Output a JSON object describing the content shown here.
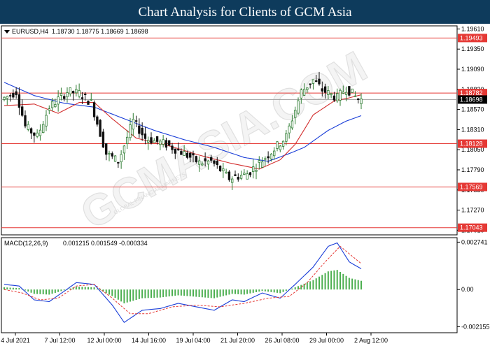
{
  "banner": {
    "title": "Chart Analysis for Clients of GCM Asia"
  },
  "header": {
    "symbol": "EURUSD,H4",
    "ohlc": "1.18730 1.18775 1.18669 1.18698"
  },
  "watermark": {
    "main": "GCMASIA.COM",
    "small": "GLOBAL FINANCIAL MARKETS"
  },
  "colors": {
    "up": "#2e7d32",
    "down": "#111111",
    "ma_fast": "#d32f2f",
    "ma_slow": "#1a3ed8",
    "level": "#e53935",
    "macd_hist": "#4caf50",
    "macd_line": "#1a3ed8",
    "signal": "#e53935"
  },
  "chart_data": [
    {
      "type": "candlestick",
      "title": "EURUSD,H4",
      "y_ticks": [
        "1.19610",
        "1.19350",
        "1.19090",
        "1.18830",
        "1.18570",
        "1.18310",
        "1.18050",
        "1.17790",
        "1.17530",
        "1.17270",
        "1.17010"
      ],
      "ylim": [
        1.1695,
        1.1965
      ],
      "horizontal_levels": [
        "1.19493",
        "1.18782",
        "1.18128",
        "1.17569",
        "1.17043"
      ],
      "current_price": "1.18698",
      "x_labels": [
        "4 Jul 2021",
        "7 Jul 12:00",
        "12 Jul 00:00",
        "14 Jul 16:00",
        "19 Jul 04:00",
        "21 Jul 20:00",
        "26 Jul 08:00",
        "29 Jul 00:00",
        "2 Aug 12:00"
      ],
      "candle_count": 120,
      "path_anchors": [
        [
          0,
          1.187
        ],
        [
          5,
          1.188
        ],
        [
          8,
          1.1835
        ],
        [
          12,
          1.1822
        ],
        [
          16,
          1.186
        ],
        [
          22,
          1.188
        ],
        [
          26,
          1.1878
        ],
        [
          30,
          1.1866
        ],
        [
          35,
          1.18
        ],
        [
          39,
          1.179
        ],
        [
          44,
          1.1842
        ],
        [
          48,
          1.182
        ],
        [
          55,
          1.1812
        ],
        [
          61,
          1.18
        ],
        [
          66,
          1.1788
        ],
        [
          70,
          1.179
        ],
        [
          76,
          1.1768
        ],
        [
          82,
          1.1774
        ],
        [
          88,
          1.1795
        ],
        [
          92,
          1.181
        ],
        [
          95,
          1.1822
        ],
        [
          100,
          1.188
        ],
        [
          104,
          1.1895
        ],
        [
          107,
          1.1882
        ],
        [
          112,
          1.1872
        ],
        [
          115,
          1.1885
        ],
        [
          119,
          1.187
        ]
      ],
      "ma_fast_anchors": [
        [
          0,
          1.1862
        ],
        [
          10,
          1.1864
        ],
        [
          18,
          1.1852
        ],
        [
          25,
          1.1866
        ],
        [
          30,
          1.1866
        ],
        [
          36,
          1.1845
        ],
        [
          44,
          1.182
        ],
        [
          55,
          1.181
        ],
        [
          65,
          1.1798
        ],
        [
          75,
          1.1788
        ],
        [
          85,
          1.178
        ],
        [
          92,
          1.1792
        ],
        [
          97,
          1.1812
        ],
        [
          103,
          1.185
        ],
        [
          110,
          1.1868
        ],
        [
          115,
          1.1872
        ],
        [
          119,
          1.1876
        ]
      ],
      "ma_slow_anchors": [
        [
          0,
          1.1892
        ],
        [
          10,
          1.1875
        ],
        [
          20,
          1.1865
        ],
        [
          30,
          1.186
        ],
        [
          40,
          1.1845
        ],
        [
          50,
          1.183
        ],
        [
          60,
          1.1818
        ],
        [
          70,
          1.1808
        ],
        [
          80,
          1.1795
        ],
        [
          88,
          1.179
        ],
        [
          95,
          1.18
        ],
        [
          100,
          1.1808
        ],
        [
          108,
          1.183
        ],
        [
          114,
          1.1842
        ],
        [
          119,
          1.1849
        ]
      ]
    },
    {
      "type": "macd",
      "title": "MACD(12,26,9)",
      "values_label": "0.001215 0.001549 -0.000334",
      "y_ticks": [
        "0.002741",
        "0.00",
        "-0.002155"
      ],
      "ylim": [
        -0.0025,
        0.003
      ],
      "macd_anchors": [
        [
          0,
          0.0003
        ],
        [
          5,
          0.0002
        ],
        [
          10,
          -0.0006
        ],
        [
          15,
          -0.0007
        ],
        [
          20,
          -0.0001
        ],
        [
          24,
          0.0004
        ],
        [
          30,
          0.0003
        ],
        [
          36,
          -0.0009
        ],
        [
          40,
          -0.0019
        ],
        [
          46,
          -0.0012
        ],
        [
          52,
          -0.0011
        ],
        [
          58,
          -0.0008
        ],
        [
          64,
          -0.001
        ],
        [
          70,
          -0.0012
        ],
        [
          76,
          -0.0006
        ],
        [
          80,
          -0.0007
        ],
        [
          86,
          -0.0002
        ],
        [
          92,
          -0.0005
        ],
        [
          97,
          0.0003
        ],
        [
          103,
          0.0013
        ],
        [
          108,
          0.0025
        ],
        [
          111,
          0.0027
        ],
        [
          115,
          0.0016
        ],
        [
          119,
          0.0012
        ]
      ],
      "signal_anchors": [
        [
          0,
          0.0
        ],
        [
          6,
          -0.0002
        ],
        [
          12,
          -0.0006
        ],
        [
          18,
          -0.0005
        ],
        [
          24,
          0.0002
        ],
        [
          30,
          0.0003
        ],
        [
          36,
          -0.0005
        ],
        [
          42,
          -0.0014
        ],
        [
          48,
          -0.0014
        ],
        [
          56,
          -0.001
        ],
        [
          64,
          -0.0009
        ],
        [
          72,
          -0.001
        ],
        [
          80,
          -0.0008
        ],
        [
          88,
          -0.0005
        ],
        [
          95,
          -0.0004
        ],
        [
          101,
          0.0004
        ],
        [
          107,
          0.0016
        ],
        [
          112,
          0.0025
        ],
        [
          119,
          0.0015
        ]
      ]
    }
  ]
}
